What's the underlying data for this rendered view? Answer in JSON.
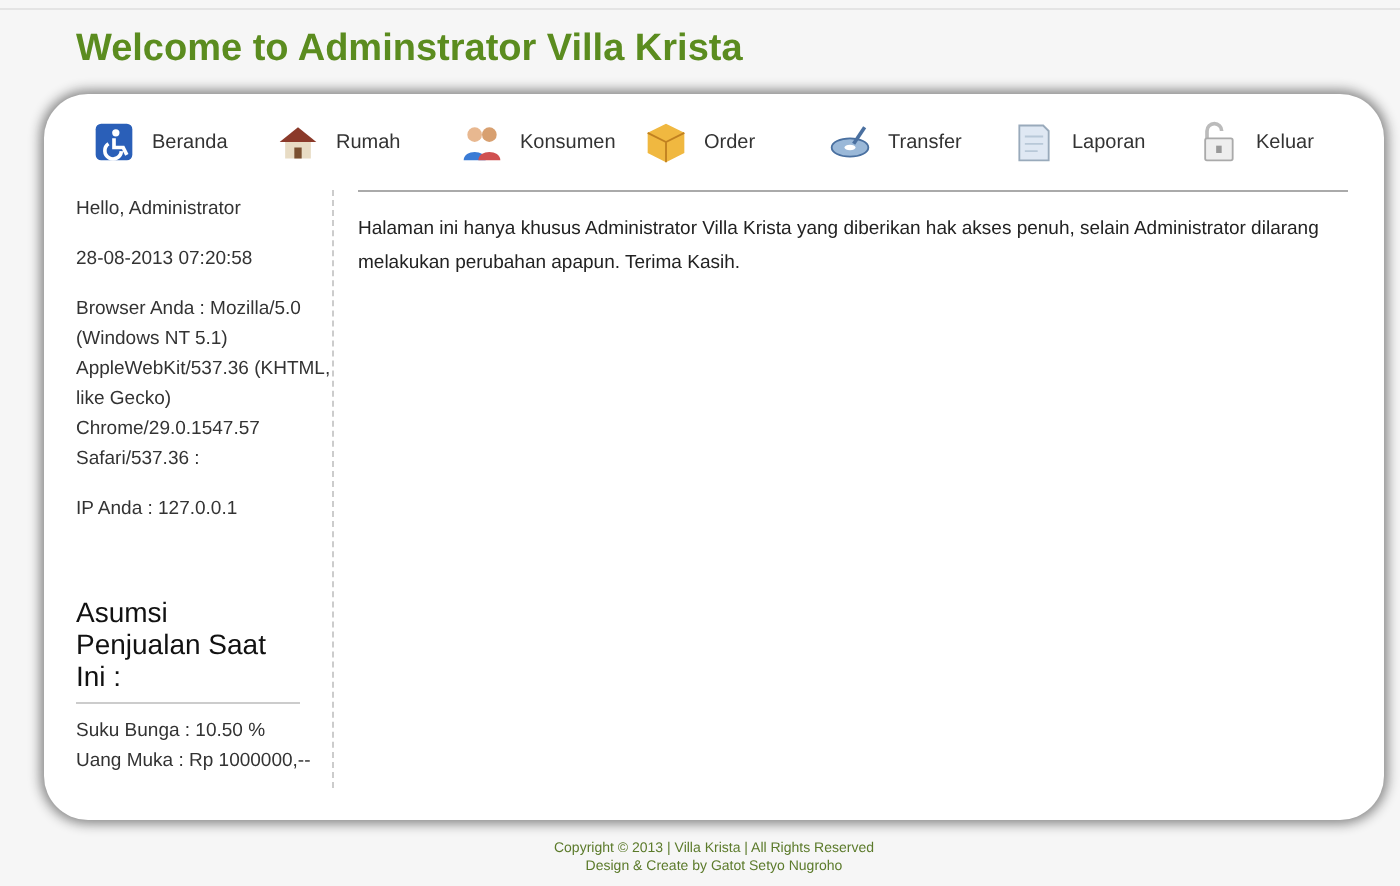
{
  "title": "Welcome to Adminstrator Villa Krista",
  "nav": [
    {
      "label": "Beranda",
      "kind": "home"
    },
    {
      "label": "Rumah",
      "kind": "house"
    },
    {
      "label": "Konsumen",
      "kind": "people"
    },
    {
      "label": "Order",
      "kind": "box"
    },
    {
      "label": "Transfer",
      "kind": "disc"
    },
    {
      "label": "Laporan",
      "kind": "paper"
    },
    {
      "label": "Keluar",
      "kind": "lock"
    }
  ],
  "sidebar": {
    "greeting": "Hello, Administrator",
    "datetime": "28-08-2013 07:20:58",
    "browser": "Browser Anda : Mozilla/5.0 (Windows NT 5.1) AppleWebKit/537.36 (KHTML, like Gecko) Chrome/29.0.1547.57 Safari/537.36 :",
    "ip": "IP Anda : 127.0.0.1",
    "heading": "Asumsi Penjualan Saat Ini :",
    "lines": [
      "Suku Bunga : 10.50 %",
      "Uang Muka : Rp 1000000,--"
    ]
  },
  "content": "Halaman ini hanya khusus Administrator Villa Krista yang diberikan hak akses penuh, selain Administrator dilarang melakukan perubahan apapun. Terima Kasih.",
  "footer": [
    "Copyright © 2013 | Villa Krista | All Rights Reserved",
    "Design & Create by Gatot Setyo Nugroho"
  ]
}
